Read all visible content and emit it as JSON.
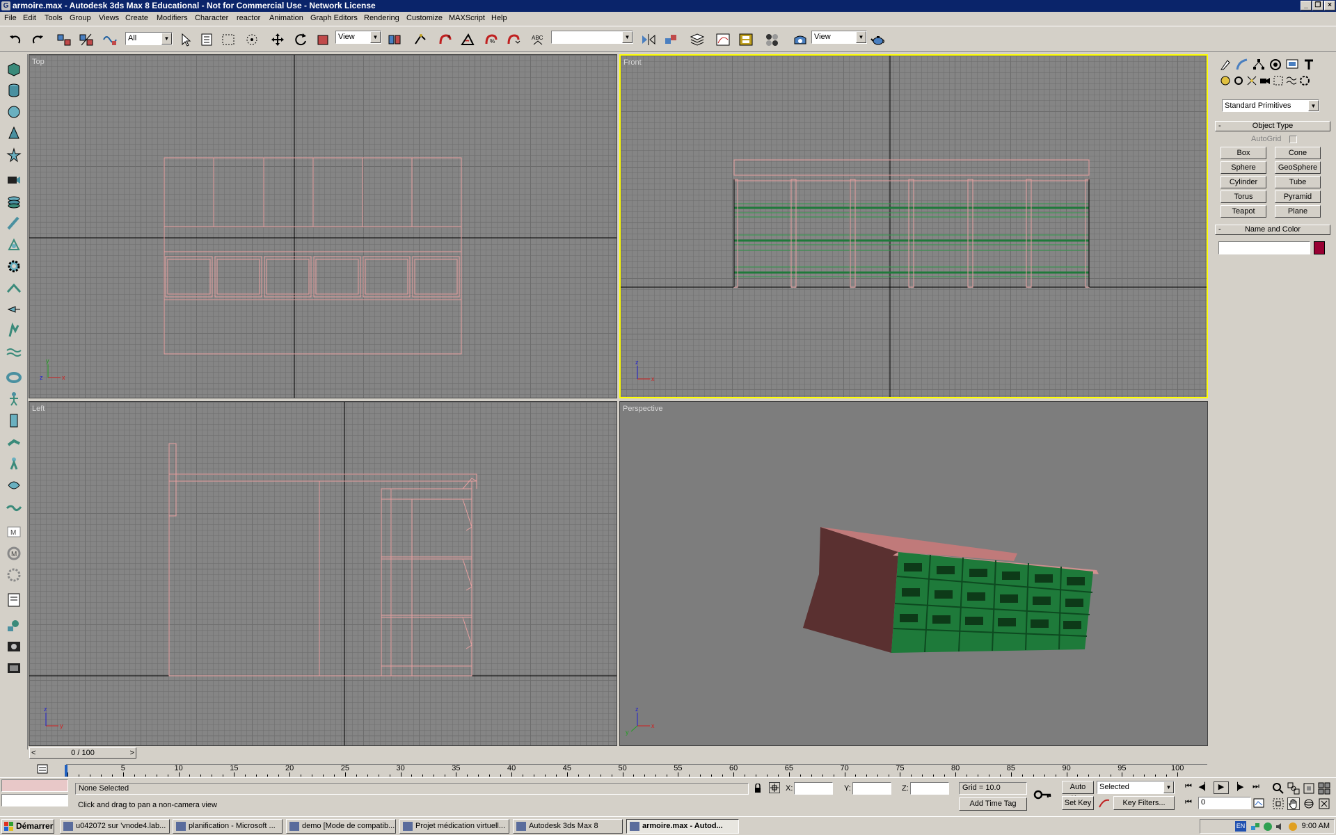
{
  "window": {
    "title": "armoire.max - Autodesk 3ds Max 8  Educational - Not for Commercial Use - Network License"
  },
  "menu": [
    "File",
    "Edit",
    "Tools",
    "Group",
    "Views",
    "Create",
    "Modifiers",
    "Character",
    "reactor",
    "Animation",
    "Graph Editors",
    "Rendering",
    "Customize",
    "MAXScript",
    "Help"
  ],
  "toolbar": {
    "selection_filter": "All",
    "ref_coord": "View",
    "named_selection": "",
    "render_type": "View"
  },
  "viewports": {
    "top": "Top",
    "front": "Front",
    "left": "Left",
    "perspective": "Perspective"
  },
  "axes": {
    "x": "x",
    "y": "y",
    "z": "z"
  },
  "command_panel": {
    "dropdown": "Standard Primitives",
    "object_type": {
      "title": "Object Type",
      "autogrid": "AutoGrid",
      "buttons": [
        "Box",
        "Cone",
        "Sphere",
        "GeoSphere",
        "Cylinder",
        "Tube",
        "Torus",
        "Pyramid",
        "Teapot",
        "Plane"
      ]
    },
    "name_color": {
      "title": "Name and Color",
      "name": "",
      "color": "#990033"
    }
  },
  "timeline": {
    "frame": "0 / 100",
    "ticks": [
      "0",
      "5",
      "10",
      "15",
      "20",
      "25",
      "30",
      "35",
      "40",
      "45",
      "50",
      "55",
      "60",
      "65",
      "70",
      "75",
      "80",
      "85",
      "90",
      "95",
      "100"
    ]
  },
  "status": {
    "selection": "None Selected",
    "prompt": "Click and drag to pan a non-camera view",
    "x_label": "X:",
    "y_label": "Y:",
    "z_label": "Z:",
    "grid": "Grid = 10.0",
    "add_time_tag": "Add Time Tag",
    "auto_key": "Auto Key",
    "set_key": "Set Key",
    "key_mode": "Selected",
    "key_filters": "Key Filters...",
    "current_frame": "0"
  },
  "taskbar": {
    "start": "Démarrer",
    "tasks": [
      "u042072 sur 'vnode4.lab...",
      "planification - Microsoft ...",
      "demo [Mode de compatib...",
      "Projet médication virtuell...",
      "Autodesk 3ds Max 8",
      "armoire.max - Autod..."
    ],
    "lang": "EN",
    "clock": "9:00 AM"
  },
  "colors": {
    "wire": "#e8a0a0",
    "shelf_green": "#1e7a3a",
    "active_border": "#ffff00",
    "persp_bg": "#7d7d7d"
  }
}
